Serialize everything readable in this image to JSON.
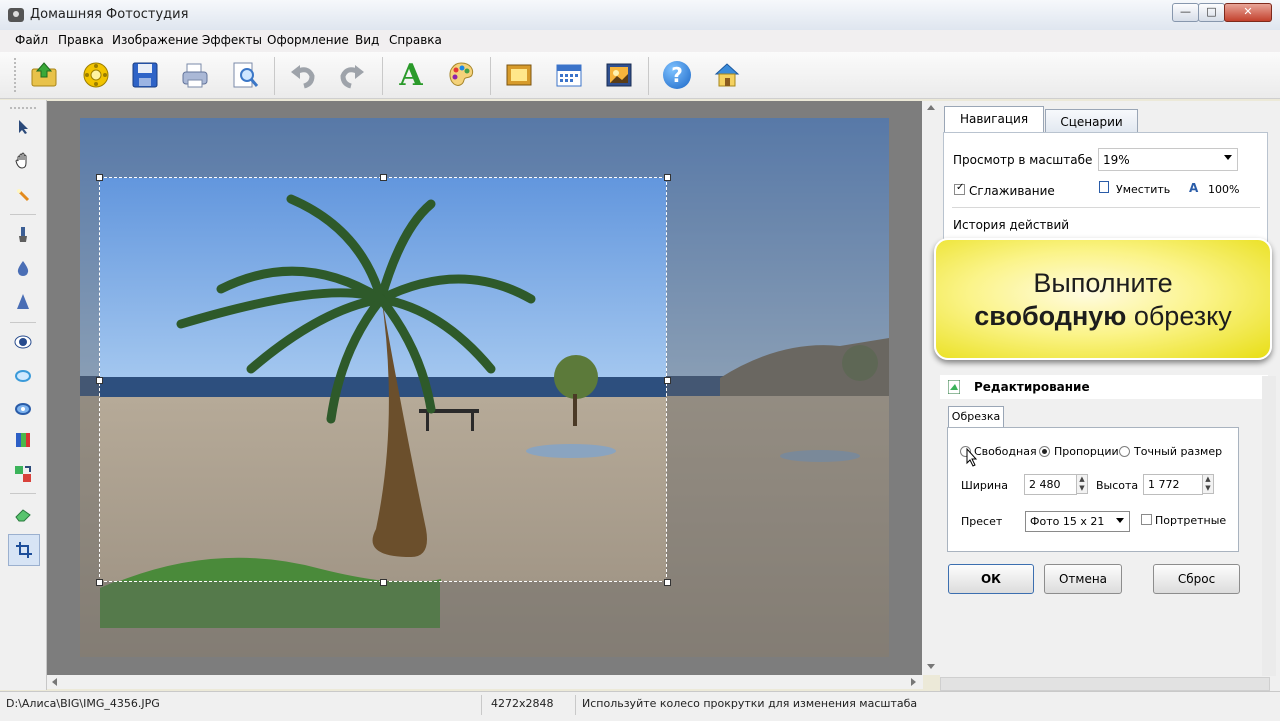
{
  "window": {
    "title": "Домашняя Фотостудия",
    "controls": {
      "minimize": "—",
      "maximize": "□",
      "close": "✕"
    }
  },
  "menu": [
    "Файл",
    "Правка",
    "Изображение",
    "Эффекты",
    "Оформление",
    "Вид",
    "Справка"
  ],
  "toolbar": {
    "buttons": [
      "open-icon",
      "gallery-icon",
      "save-icon",
      "print-icon",
      "preview-icon",
      "undo-icon",
      "redo-icon",
      "text-icon",
      "palette-icon",
      "frame-icon",
      "calendar-icon",
      "collage-icon",
      "help-icon",
      "home-icon"
    ],
    "text_glyph": "A",
    "help_glyph": "?"
  },
  "left_tools": [
    "pointer-icon",
    "hand-icon",
    "zoom-icon",
    "brush-icon",
    "drop-icon",
    "sharpen-icon",
    "red-eye-icon",
    "oval-select-icon",
    "rect-select-icon",
    "color-bars-icon",
    "transform-icon",
    "eraser-icon",
    "crop-icon"
  ],
  "nav": {
    "tabs": [
      "Навигация",
      "Сценарии"
    ],
    "zoom_label": "Просмотр в масштабе",
    "zoom_value": "19%",
    "smoothing_label": "Сглаживание",
    "smoothing_checked": true,
    "fit_label": "Уместить",
    "full_label": "100%",
    "history_label": "История действий"
  },
  "callout": {
    "line1": "Выполните",
    "bold": "свободную",
    "rest": " обрезку"
  },
  "edit": {
    "header": "Редактирование",
    "tab": "Обрезка",
    "modes": [
      "Свободная",
      "Пропорции",
      "Точный размер"
    ],
    "selected_mode": "Пропорции",
    "width_label": "Ширина",
    "width_value": "2 480",
    "height_label": "Высота",
    "height_value": "1 772",
    "preset_label": "Пресет",
    "preset_value": "Фото 15 x 21",
    "portrait_label": "Портретные",
    "portrait_checked": false
  },
  "buttons": {
    "ok": "ОК",
    "cancel": "Отмена",
    "reset": "Сброс"
  },
  "status": {
    "path": "D:\\Алиса\\BIG\\IMG_4356.JPG",
    "size": "4272x2848",
    "hint": "Используйте колесо прокрутки для изменения масштаба"
  },
  "colors": {
    "accent": "#1d6fb8",
    "callout": "#f4ec3c"
  }
}
